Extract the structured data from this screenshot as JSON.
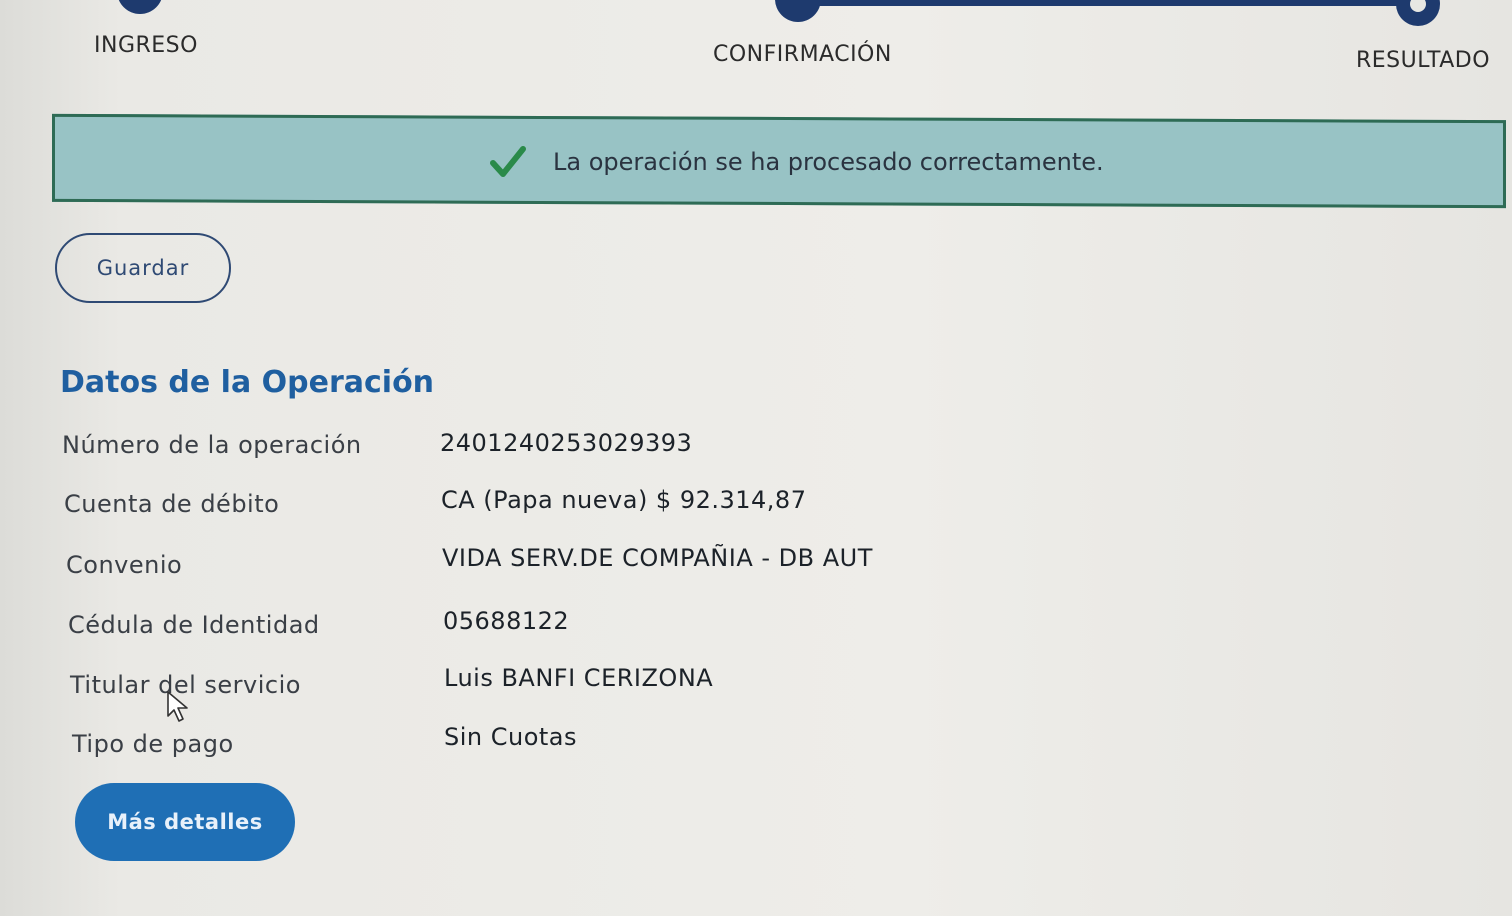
{
  "stepper": {
    "steps": [
      {
        "label": "INGRESO"
      },
      {
        "label": "CONFIRMACIÓN"
      },
      {
        "label": "RESULTADO"
      }
    ]
  },
  "banner": {
    "message": "La operación se ha procesado correctamente.",
    "icon": "check-icon",
    "color": "#98c3c5"
  },
  "actions": {
    "save_label": "Guardar",
    "details_label": "Más detalles"
  },
  "operation": {
    "title": "Datos de la Operación",
    "rows": [
      {
        "label": "Número de la operación",
        "value": "2401240253029393"
      },
      {
        "label": "Cuenta de débito",
        "value": "CA (Papa nueva) $ 92.314,87"
      },
      {
        "label": "Convenio",
        "value": "VIDA SERV.DE COMPAÑIA - DB AUT"
      },
      {
        "label": "Cédula de Identidad",
        "value": "05688122"
      },
      {
        "label": "Titular del servicio",
        "value": "Luis BANFI CERIZONA"
      },
      {
        "label": "Tipo de pago",
        "value": "Sin Cuotas"
      }
    ]
  },
  "colors": {
    "primary": "#1f6fb5",
    "stepper": "#1e3a6e",
    "success_border": "#2e6b55"
  }
}
